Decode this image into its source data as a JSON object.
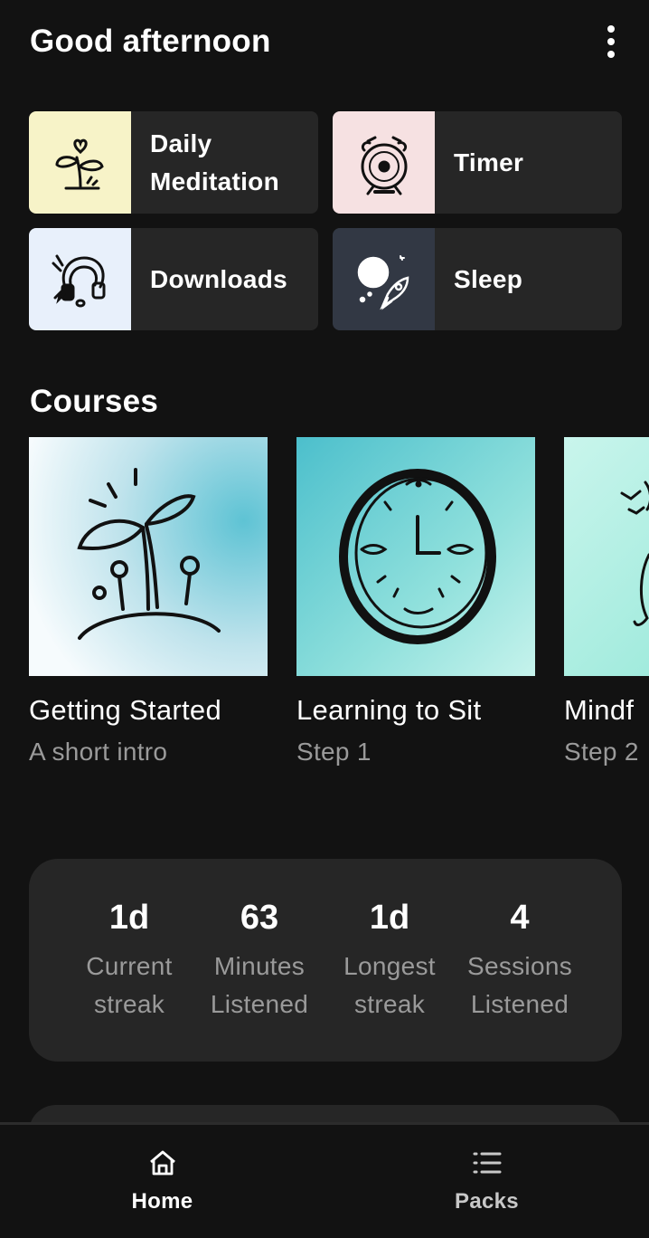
{
  "header": {
    "greeting": "Good afternoon",
    "menu_icon": "more-vertical-icon"
  },
  "tiles": [
    {
      "label": "Daily\nMeditation",
      "icon": "sprout-heart-icon",
      "bg": "#f7f3c8"
    },
    {
      "label": "Timer",
      "icon": "alarm-clock-icon",
      "bg": "#f6e1e2"
    },
    {
      "label": "Downloads",
      "icon": "headphones-icon",
      "bg": "#e8f0fb"
    },
    {
      "label": "Sleep",
      "icon": "moon-rocket-icon",
      "bg": "#323844"
    }
  ],
  "courses": {
    "title": "Courses",
    "items": [
      {
        "title": "Getting Started",
        "subtitle": "A short intro",
        "icon": "sprout-icon"
      },
      {
        "title": "Learning to Sit",
        "subtitle": "Step 1",
        "icon": "clock-face-icon"
      },
      {
        "title": "Mindf",
        "subtitle": "Step 2",
        "icon": "birds-icon"
      }
    ]
  },
  "stats": [
    {
      "value": "1d",
      "label_line1": "Current",
      "label_line2": "streak"
    },
    {
      "value": "63",
      "label_line1": "Minutes",
      "label_line2": "Listened"
    },
    {
      "value": "1d",
      "label_line1": "Longest",
      "label_line2": "streak"
    },
    {
      "value": "4",
      "label_line1": "Sessions",
      "label_line2": "Listened"
    }
  ],
  "nav": [
    {
      "label": "Home",
      "icon": "home-icon",
      "color": "#ffffff"
    },
    {
      "label": "Packs",
      "icon": "list-icon",
      "color": "#c8c8c8"
    }
  ]
}
